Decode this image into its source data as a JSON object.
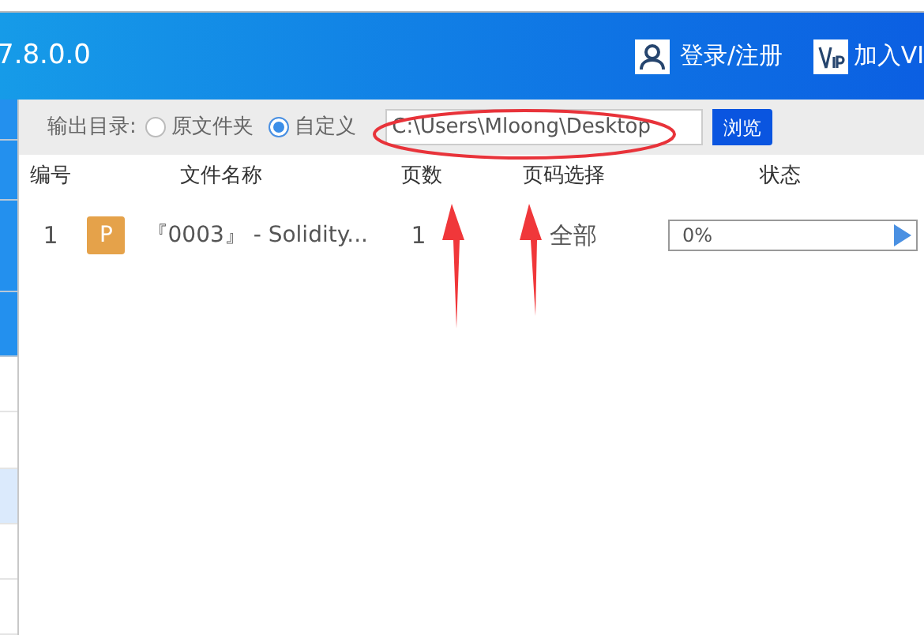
{
  "header": {
    "version": "7.8.0.0",
    "login": "登录/注册",
    "vip": "加入VI"
  },
  "sidebar": {
    "items": [
      {
        "kind": "band"
      },
      {
        "kind": "band"
      },
      {
        "kind": "band"
      },
      {
        "kind": "band"
      },
      {
        "kind": "item",
        "selected": false
      },
      {
        "kind": "item",
        "selected": false
      },
      {
        "kind": "item",
        "selected": true
      },
      {
        "kind": "item",
        "selected": false
      },
      {
        "kind": "item",
        "selected": false
      }
    ]
  },
  "output": {
    "label": "输出目录:",
    "options": [
      {
        "label": "原文件夹",
        "selected": false
      },
      {
        "label": "自定义",
        "selected": true
      }
    ],
    "path": "C:\\Users\\Mloong\\Desktop",
    "browse": "浏览"
  },
  "table": {
    "columns": [
      "编号",
      "文件名称",
      "页数",
      "页码选择",
      "状态"
    ],
    "rows": [
      {
        "number": "1",
        "badge": "P",
        "name": "『0003』 -  Solidity...",
        "pages": "1",
        "range": "全部",
        "progress": "0%",
        "level": 0
      }
    ]
  }
}
